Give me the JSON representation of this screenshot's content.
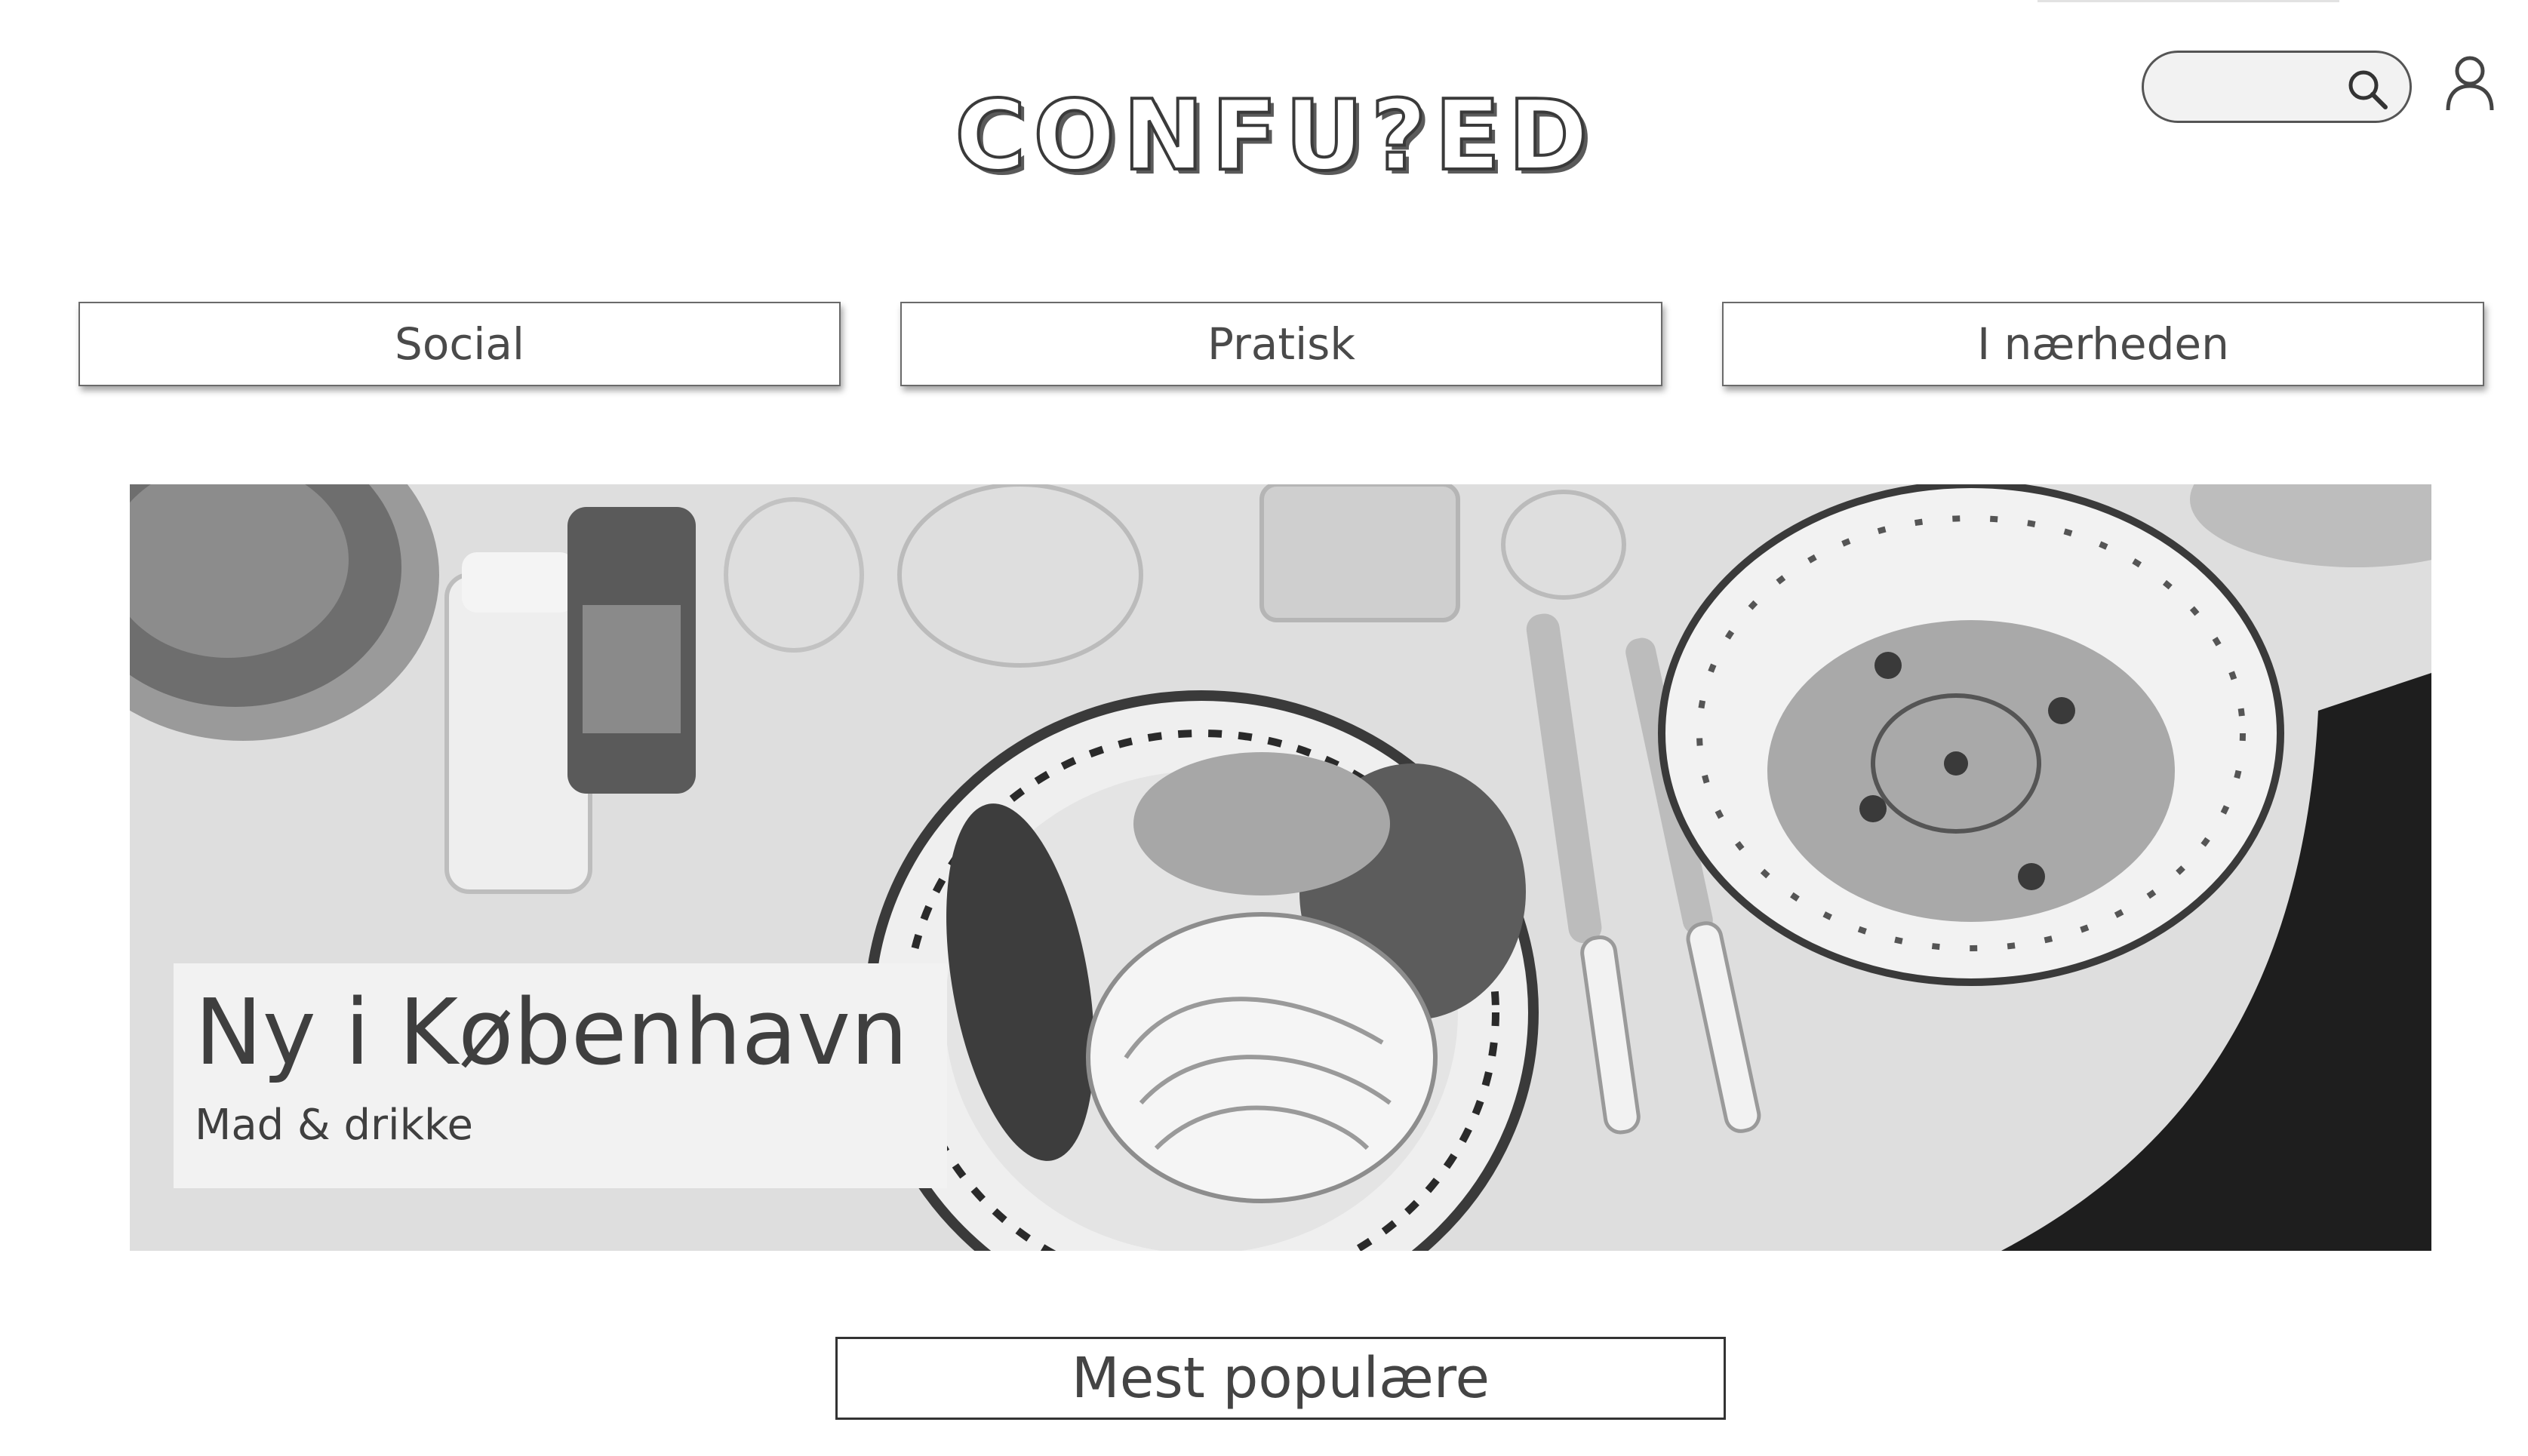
{
  "header": {
    "logo_text": "CONFU?ED",
    "search": {
      "placeholder": "",
      "icon": "search-icon"
    },
    "user_icon": "user-icon"
  },
  "categories": [
    {
      "label": "Social"
    },
    {
      "label": "Pratisk"
    },
    {
      "label": "I nærheden"
    }
  ],
  "hero": {
    "title": "Ny i København",
    "subtitle": "Mad & drikke",
    "image": "grayscale photo of a dinner table with a pasta plate, soup bowl, cutlery, glasses and salt and pepper grinders"
  },
  "section": {
    "label": "Mest populære"
  },
  "colors": {
    "text": "#3d3d3d",
    "caption_bg": "#f2f2f2",
    "border": "#333333"
  }
}
